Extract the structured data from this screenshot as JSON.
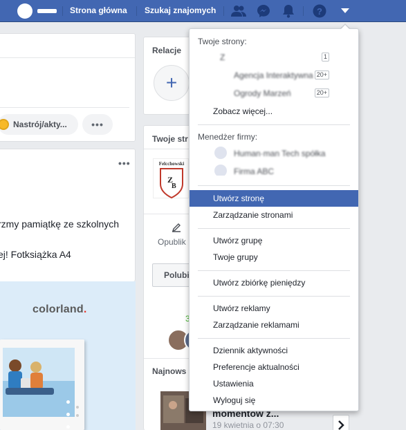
{
  "topbar": {
    "home_label": "Strona główna",
    "find_friends_label": "Szukaj znajomych"
  },
  "composer": {
    "mood_label": "Nastrój/akty...",
    "more_label": "•••"
  },
  "post": {
    "more_label": "•••",
    "line1": "rzmy pamiątkę ze szkolnych",
    "line2": "ej! Fotksiążka A4"
  },
  "ad": {
    "brand_main": "colorland",
    "brand_dot": "."
  },
  "right": {
    "relations_title": "Relacje",
    "add_symbol": "+",
    "your_pages_title": "Twoje str",
    "page_logo_text": "Felcchowski",
    "publish_label": "Opublik",
    "like_label": "Polubi",
    "count_text": "3",
    "newest_title": "Najnows",
    "story_title": "momentów z...",
    "story_date": "19 kwietnia o 07:30"
  },
  "menu": {
    "your_pages_header": "Twoje strony:",
    "pages": [
      {
        "name": "Z",
        "badge": "1"
      },
      {
        "name": "Agencja Interaktywna ...",
        "badge": "20+"
      },
      {
        "name": "Ogrody Marzeń",
        "badge": "20+"
      }
    ],
    "see_more": "Zobacz więcej...",
    "business_header": "Menedżer firmy:",
    "businesses": [
      {
        "name": "Human·man Tech spółka"
      },
      {
        "name": "Firma ABC"
      }
    ],
    "items": {
      "create_page": "Utwórz stronę",
      "manage_pages": "Zarządzanie stronami",
      "create_group": "Utwórz grupę",
      "your_groups": "Twoje grupy",
      "create_fundraiser": "Utwórz zbiórkę pieniędzy",
      "create_ads": "Utwórz reklamy",
      "manage_ads": "Zarządzanie reklamami",
      "activity_log": "Dziennik aktywności",
      "news_prefs": "Preferencje aktualności",
      "settings": "Ustawienia",
      "logout": "Wyloguj się"
    }
  },
  "colors": {
    "brand_blue": "#4267b2",
    "highlight": "#4267b2",
    "background": "#e9ebee"
  }
}
